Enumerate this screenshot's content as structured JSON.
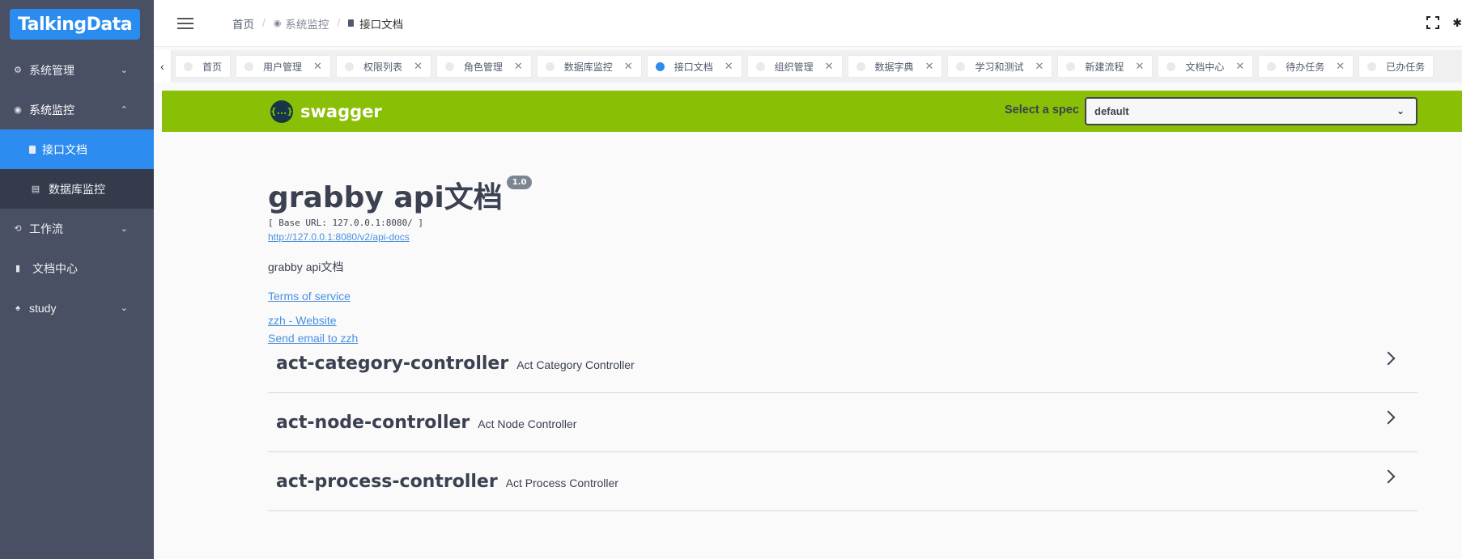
{
  "brand": "TalkingData",
  "sidebar": {
    "items": [
      {
        "label": "系统管理",
        "icon": "gear-icon"
      },
      {
        "label": "系统监控",
        "icon": "eye-icon",
        "open": true
      },
      {
        "label": "工作流",
        "icon": "workflow-icon"
      },
      {
        "label": "文档中心",
        "icon": "document-icon"
      },
      {
        "label": "study",
        "icon": "bell-icon"
      }
    ],
    "submenu": [
      {
        "label": "接口文档",
        "active": true
      },
      {
        "label": "数据库监控"
      }
    ]
  },
  "header": {
    "breadcrumb": [
      "首页",
      "系统监控",
      "接口文档"
    ]
  },
  "tabs": [
    {
      "label": "首页",
      "closable": false
    },
    {
      "label": "用户管理",
      "closable": true
    },
    {
      "label": "权限列表",
      "closable": true
    },
    {
      "label": "角色管理",
      "closable": true
    },
    {
      "label": "数据库监控",
      "closable": true
    },
    {
      "label": "接口文档",
      "closable": true,
      "active": true
    },
    {
      "label": "组织管理",
      "closable": true
    },
    {
      "label": "数据字典",
      "closable": true
    },
    {
      "label": "学习和测试",
      "closable": true
    },
    {
      "label": "新建流程",
      "closable": true
    },
    {
      "label": "文档中心",
      "closable": true
    },
    {
      "label": "待办任务",
      "closable": true
    },
    {
      "label": "已办任务",
      "closable": false
    }
  ],
  "swagger": {
    "logo_text": "swagger",
    "logo_symbol": "{...}",
    "spec_label": "Select a spec",
    "spec_value": "default",
    "title": "grabby api文档",
    "version": "1.0",
    "base_url": "[ Base URL: 127.0.0.1:8080/ ]",
    "api_docs_url": "http://127.0.0.1:8080/v2/api-docs",
    "description": "grabby api文档",
    "terms": "Terms of service",
    "website": "zzh - Website",
    "email": "Send email to zzh",
    "controllers": [
      {
        "name": "act-category-controller",
        "desc": "Act Category Controller"
      },
      {
        "name": "act-node-controller",
        "desc": "Act Node Controller"
      },
      {
        "name": "act-process-controller",
        "desc": "Act Process Controller"
      }
    ]
  },
  "colors": {
    "sidebar_bg": "#4a5064",
    "accent": "#2d8cf0",
    "swagger_green": "#89bf04"
  }
}
